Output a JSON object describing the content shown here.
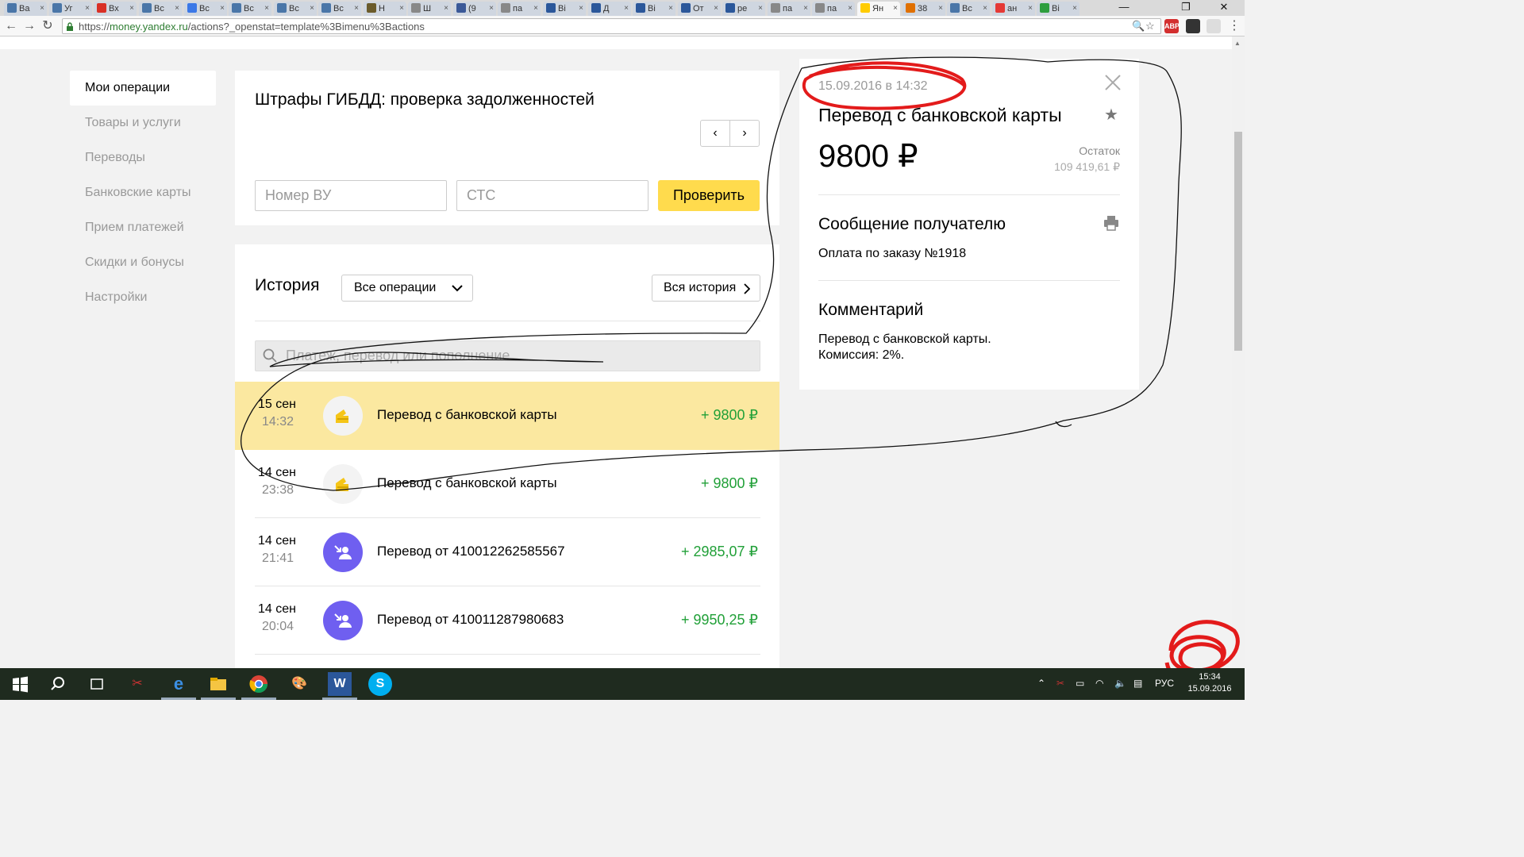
{
  "browser": {
    "tabs": [
      {
        "label": "Ва",
        "color": "#4a76a8"
      },
      {
        "label": "Уг",
        "color": "#4a76a8"
      },
      {
        "label": "Вх",
        "color": "#d93025"
      },
      {
        "label": "Вс",
        "color": "#4a76a8"
      },
      {
        "label": "Вс",
        "color": "#3b78e7"
      },
      {
        "label": "Вс",
        "color": "#4a76a8"
      },
      {
        "label": "Вс",
        "color": "#4a76a8"
      },
      {
        "label": "Вс",
        "color": "#4a76a8"
      },
      {
        "label": "Н",
        "color": "#6b5b2a"
      },
      {
        "label": "Ш",
        "color": "#888888"
      },
      {
        "label": "(9",
        "color": "#3b5998"
      },
      {
        "label": "па",
        "color": "#888888"
      },
      {
        "label": "Ві",
        "color": "#2b579a"
      },
      {
        "label": "Д",
        "color": "#2b579a"
      },
      {
        "label": "Ві",
        "color": "#2b579a"
      },
      {
        "label": "От",
        "color": "#2b579a"
      },
      {
        "label": "ре",
        "color": "#2b579a"
      },
      {
        "label": "па",
        "color": "#888888"
      },
      {
        "label": "па",
        "color": "#888888"
      },
      {
        "label": "Ян",
        "color": "#ffcc00"
      },
      {
        "label": "38",
        "color": "#e07000"
      },
      {
        "label": "Вс",
        "color": "#4a76a8"
      },
      {
        "label": "ан",
        "color": "#e53935"
      },
      {
        "label": "Ві",
        "color": "#2e9e3e"
      }
    ],
    "url_scheme": "https://",
    "url_host": "money.yandex.ru",
    "url_path": "/actions?_openstat=template%3Bimenu%3Bactions",
    "ext_abp": "ABP",
    "win_min": "—",
    "win_restore": "❐",
    "win_close": "✕"
  },
  "sidebar": {
    "items": [
      {
        "label": "Мои операции"
      },
      {
        "label": "Товары и услуги"
      },
      {
        "label": "Переводы"
      },
      {
        "label": "Банковские карты"
      },
      {
        "label": "Прием платежей"
      },
      {
        "label": "Скидки и бонусы"
      },
      {
        "label": "Настройки"
      }
    ]
  },
  "fines": {
    "title": "Штрафы ГИБДД: проверка задолженностей",
    "prev": "‹",
    "next": "›",
    "field1_placeholder": "Номер ВУ",
    "field2_placeholder": "СТС",
    "check_label": "Проверить"
  },
  "history": {
    "title": "История",
    "filter_value": "Все операции",
    "all_history_label": "Вся история",
    "search_placeholder": "Платеж, перевод или пополнение",
    "operations": [
      {
        "date": "15 сен",
        "time": "14:32",
        "title": "Перевод с банковской карты",
        "amount": "+ 9800 ₽",
        "kind": "card",
        "highlighted": true
      },
      {
        "date": "14 сен",
        "time": "23:38",
        "title": "Перевод с банковской карты",
        "amount": "+ 9800 ₽",
        "kind": "card",
        "highlighted": false
      },
      {
        "date": "14 сен",
        "time": "21:41",
        "title": "Перевод от 410012262585567",
        "amount": "+ 2985,07 ₽",
        "kind": "user",
        "highlighted": false
      },
      {
        "date": "14 сен",
        "time": "20:04",
        "title": "Перевод от 410011287980683",
        "amount": "+ 9950,25 ₽",
        "kind": "user",
        "highlighted": false
      }
    ]
  },
  "details": {
    "datetime": "15.09.2016 в 14:32",
    "title": "Перевод с банковской карты",
    "amount": "9800 ₽",
    "balance_label": "Остаток",
    "balance_value": "109 419,61 ₽",
    "message_heading": "Сообщение получателю",
    "message_text": "Оплата по заказу №1918",
    "comment_heading": "Комментарий",
    "comment_line1": "Перевод с банковской карты.",
    "comment_line2": "Комиссия: 2%."
  },
  "taskbar": {
    "lang": "РУС",
    "time": "15:34",
    "date": "15.09.2016"
  },
  "colors": {
    "accent_yellow": "#ffdb4d",
    "highlight_row": "#fbe8a0",
    "amount_green": "#21a038",
    "user_icon_purple": "#6f5ff0",
    "annotation_red": "#e31b1b"
  }
}
